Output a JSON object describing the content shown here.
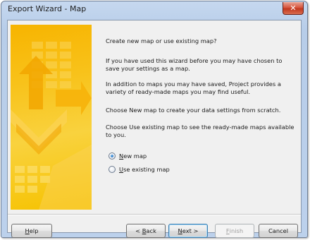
{
  "window": {
    "title": "Export Wizard - Map",
    "close_glyph": "✕"
  },
  "intro": {
    "question": "Create new map or use existing map?",
    "para_used_before": "If you have used this wizard before you may have chosen to save your settings as a map.",
    "para_ready_made": "In addition to maps you may have saved, Project provides a variety of ready-made maps you may find useful.",
    "para_new_map": "Choose New map to create your data settings from scratch.",
    "para_existing_map": "Choose Use existing map to see the ready-made maps available to you."
  },
  "options": [
    {
      "accel": "N",
      "rest": "ew map",
      "pre": "",
      "selected": true
    },
    {
      "accel": "U",
      "rest": "se existing map",
      "pre": "",
      "selected": false
    }
  ],
  "buttons": {
    "help": {
      "accel": "H",
      "rest": "elp"
    },
    "back": {
      "pre": "< ",
      "accel": "B",
      "rest": "ack"
    },
    "next": {
      "accel": "N",
      "rest": "ext >"
    },
    "finish": {
      "accel": "F",
      "rest": "inish"
    },
    "cancel": {
      "label": "Cancel"
    }
  },
  "colors": {
    "banner_primary": "#f7b400",
    "banner_light": "#fde37a",
    "client_bg": "#f0f0f0",
    "default_button_border": "#3c7fb1",
    "radio_dot": "#1e62b0"
  },
  "icons": {
    "close": "close-icon",
    "radio_selected": "radio-selected-icon",
    "radio_unselected": "radio-unselected-icon",
    "banner": "export-arrows-banner"
  }
}
